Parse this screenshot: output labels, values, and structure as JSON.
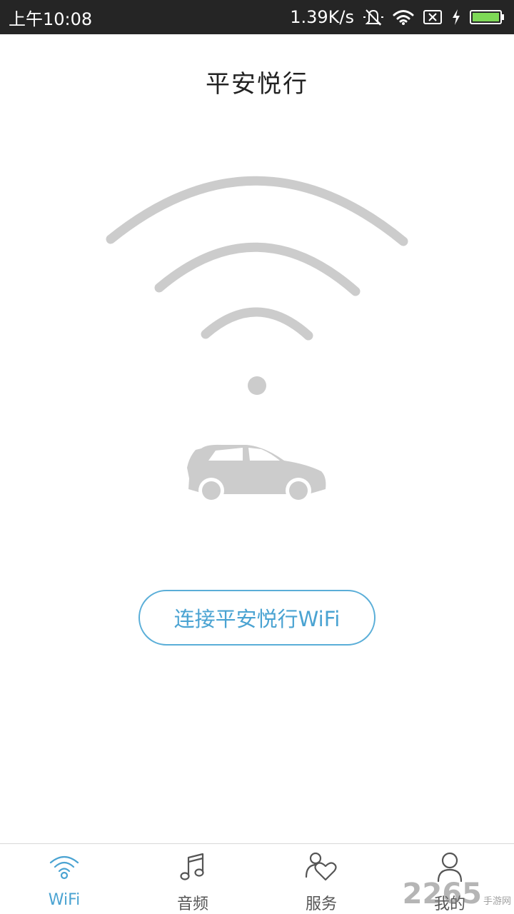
{
  "status_bar": {
    "time": "上午10:08",
    "net_speed": "1.39K/s",
    "icons": [
      "mute-icon",
      "wifi-signal-icon",
      "sim-off-icon",
      "charging-icon",
      "battery-icon"
    ]
  },
  "header": {
    "title": "平安悦行"
  },
  "hero": {
    "icons": [
      "wifi-arcs-icon",
      "car-icon"
    ],
    "color": "#cccccc"
  },
  "connect": {
    "label": "连接平安悦行WiFi",
    "color": "#4aa3d2"
  },
  "bottom_nav": {
    "items": [
      {
        "label": "WiFi",
        "icon": "wifi-icon",
        "active": true
      },
      {
        "label": "音频",
        "icon": "music-note-icon",
        "active": false
      },
      {
        "label": "服务",
        "icon": "service-heart-icon",
        "active": false
      },
      {
        "label": "我的",
        "icon": "user-icon",
        "active": false
      }
    ],
    "active_color": "#4aa3d2",
    "inactive_color": "#555555"
  },
  "watermark": {
    "number": "2265",
    "text": "手游网"
  }
}
